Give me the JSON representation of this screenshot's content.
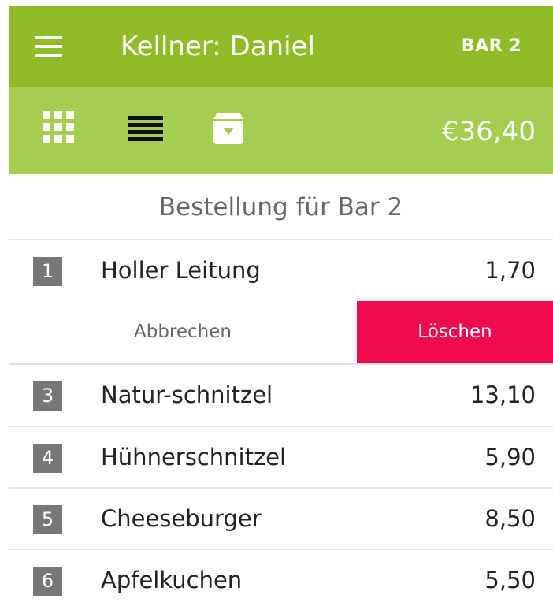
{
  "appbar": {
    "title": "Kellner: Daniel",
    "action": "BAR 2",
    "menu_icon": "hamburger-menu-icon",
    "color": "#8fbc26"
  },
  "toolbar": {
    "grid_icon": "grid-view-icon",
    "list_icon": "list-view-icon",
    "archive_icon": "archive-download-icon",
    "total": "€36,40",
    "color": "#a5cd4f"
  },
  "order": {
    "title": "Bestellung für Bar 2",
    "swipe_actions": {
      "cancel_label": "Abbrechen",
      "delete_label": "Löschen",
      "delete_color": "#f20a4e"
    },
    "items": [
      {
        "position": "1",
        "name": "Holler Leitung",
        "price": "1,70"
      },
      {
        "position": "3",
        "name": "Natur-schnitzel",
        "price": "13,10"
      },
      {
        "position": "4",
        "name": "Hühnerschnitzel",
        "price": "5,90"
      },
      {
        "position": "5",
        "name": "Cheeseburger",
        "price": "8,50"
      },
      {
        "position": "6",
        "name": "Apfelkuchen",
        "price": "5,50"
      }
    ]
  }
}
